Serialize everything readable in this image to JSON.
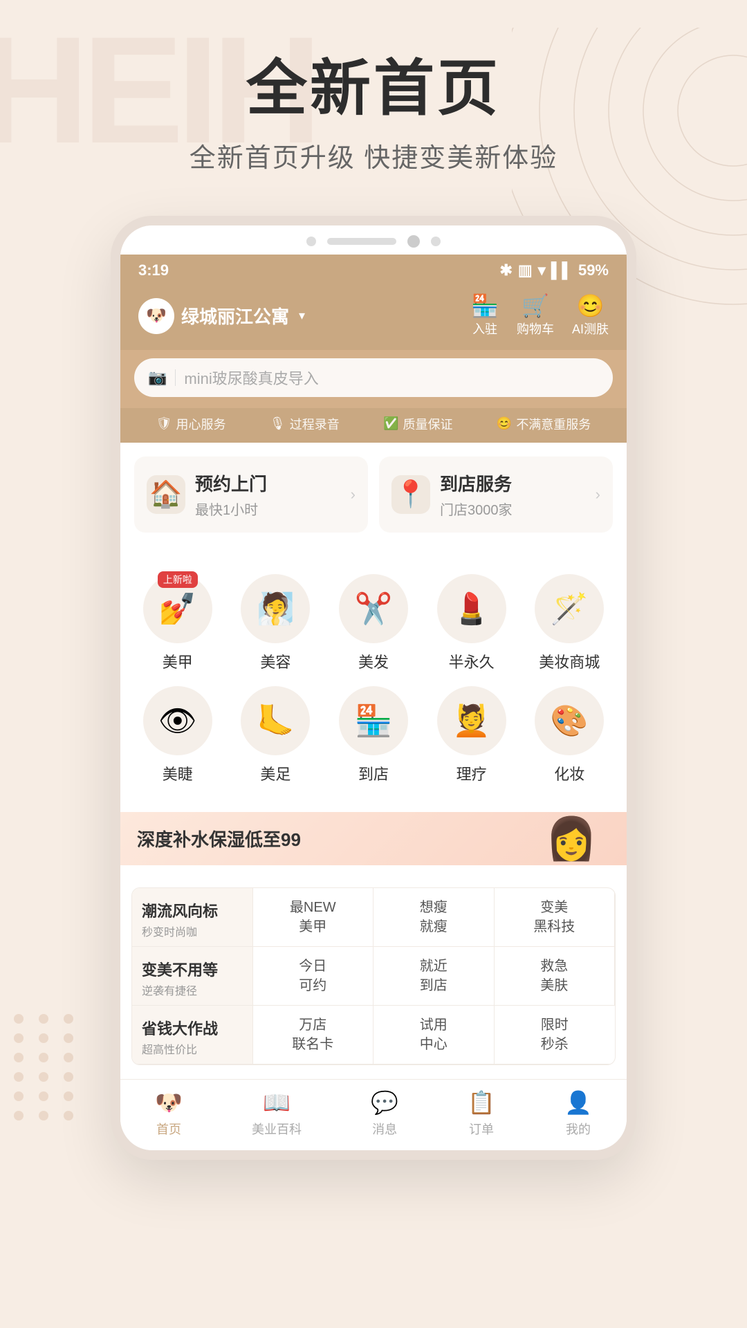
{
  "page": {
    "title": "全新首页",
    "subtitle": "全新首页升级  快捷变美新体验",
    "bg_text": "HEIH"
  },
  "phone": {
    "status": {
      "time": "3:19",
      "battery": "59%"
    },
    "header": {
      "location": "绿城丽江公寓",
      "icons": [
        {
          "label": "入驻",
          "symbol": "🏪"
        },
        {
          "label": "购物车",
          "symbol": "🛒"
        },
        {
          "label": "AI测肤",
          "symbol": "😊"
        }
      ]
    },
    "search": {
      "placeholder": "mini玻尿酸真皮导入"
    },
    "service_tags": [
      {
        "icon": "🛡",
        "text": "用心服务"
      },
      {
        "icon": "🎙",
        "text": "过程录音"
      },
      {
        "icon": "✅",
        "text": "质量保证"
      },
      {
        "icon": "😊",
        "text": "不满意重服务"
      }
    ],
    "booking_cards": [
      {
        "title": "预约上门",
        "sub": "最快1小时",
        "icon": "🏠"
      },
      {
        "title": "到店服务",
        "sub": "门店3000家",
        "icon": "📍"
      }
    ],
    "categories": [
      {
        "label": "美甲",
        "icon": "💅",
        "new": true
      },
      {
        "label": "美容",
        "icon": "🧖"
      },
      {
        "label": "美发",
        "icon": "✂️"
      },
      {
        "label": "半永久",
        "icon": "💄"
      },
      {
        "label": "美妆商城",
        "icon": "🪄"
      },
      {
        "label": "美睫",
        "icon": "👁"
      },
      {
        "label": "美足",
        "icon": "🦶"
      },
      {
        "label": "到店",
        "icon": "🏪"
      },
      {
        "label": "理疗",
        "icon": "💆"
      },
      {
        "label": "化妆",
        "icon": "🎨"
      }
    ],
    "new_badge": "上新啦",
    "promo": {
      "text": "深度补水保湿低至99"
    },
    "nav_grid": {
      "rows": [
        {
          "header": {
            "main": "潮流风向标",
            "sub": "秒变时尚咖"
          },
          "cells": [
            "最NEW\n美甲",
            "想瘦\n就瘦",
            "变美\n黑科技"
          ]
        },
        {
          "header": {
            "main": "变美不用等",
            "sub": "逆袭有捷径"
          },
          "cells": [
            "今日\n可约",
            "就近\n到店",
            "救急\n美肤"
          ]
        },
        {
          "header": {
            "main": "省钱大作战",
            "sub": "超高性价比"
          },
          "cells": [
            "万店\n联名卡",
            "试用\n中心",
            "限时\n秒杀"
          ]
        }
      ]
    },
    "bottom_nav": [
      {
        "label": "首页",
        "active": true,
        "icon": "🐶"
      },
      {
        "label": "美业百科",
        "active": false,
        "icon": "📖"
      },
      {
        "label": "消息",
        "active": false,
        "icon": "💬"
      },
      {
        "label": "订单",
        "active": false,
        "icon": "📋"
      },
      {
        "label": "我的",
        "active": false,
        "icon": "👤"
      }
    ]
  }
}
